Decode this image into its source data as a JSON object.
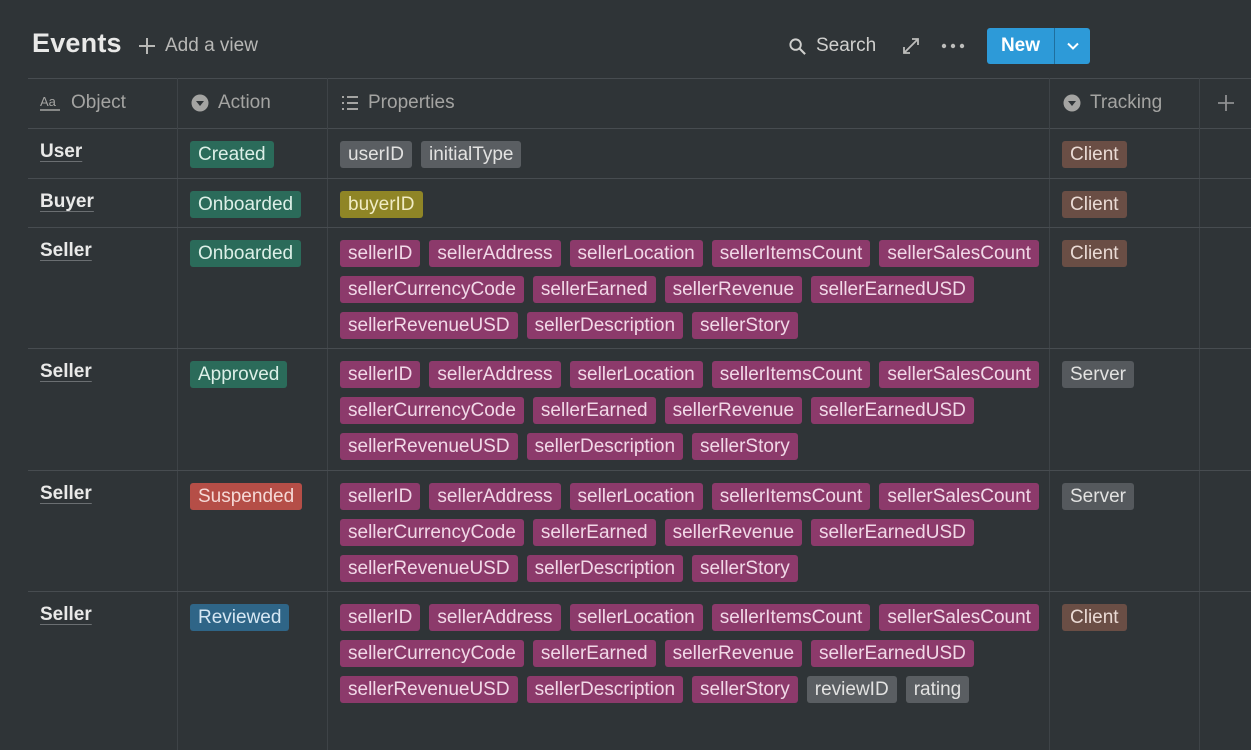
{
  "header": {
    "title": "Events",
    "add_view_label": "Add a view",
    "search_label": "Search",
    "new_label": "New"
  },
  "columns": [
    {
      "label": "Object",
      "icon": "text-aa-icon"
    },
    {
      "label": "Action",
      "icon": "select-icon"
    },
    {
      "label": "Properties",
      "icon": "list-icon"
    },
    {
      "label": "Tracking",
      "icon": "select-icon"
    }
  ],
  "rows": [
    {
      "object": "User",
      "action": "Created",
      "action_color": "green",
      "properties": [
        {
          "label": "userID",
          "color": "gray"
        },
        {
          "label": "initialType",
          "color": "gray"
        }
      ],
      "tracking": "Client",
      "tracking_color": "brown"
    },
    {
      "object": "Buyer",
      "action": "Onboarded",
      "action_color": "green",
      "properties": [
        {
          "label": "buyerID",
          "color": "yellow"
        }
      ],
      "tracking": "Client",
      "tracking_color": "brown"
    },
    {
      "object": "Seller",
      "action": "Onboarded",
      "action_color": "green",
      "properties": [
        {
          "label": "sellerID",
          "color": "pink"
        },
        {
          "label": "sellerAddress",
          "color": "pink"
        },
        {
          "label": "sellerLocation",
          "color": "pink"
        },
        {
          "label": "sellerItemsCount",
          "color": "pink"
        },
        {
          "label": "sellerSalesCount",
          "color": "pink"
        },
        {
          "label": "sellerCurrencyCode",
          "color": "pink"
        },
        {
          "label": "sellerEarned",
          "color": "pink"
        },
        {
          "label": "sellerRevenue",
          "color": "pink"
        },
        {
          "label": "sellerEarnedUSD",
          "color": "pink"
        },
        {
          "label": "sellerRevenueUSD",
          "color": "pink"
        },
        {
          "label": "sellerDescription",
          "color": "pink"
        },
        {
          "label": "sellerStory",
          "color": "pink"
        }
      ],
      "tracking": "Client",
      "tracking_color": "brown"
    },
    {
      "object": "Seller",
      "action": "Approved",
      "action_color": "green",
      "properties": [
        {
          "label": "sellerID",
          "color": "pink"
        },
        {
          "label": "sellerAddress",
          "color": "pink"
        },
        {
          "label": "sellerLocation",
          "color": "pink"
        },
        {
          "label": "sellerItemsCount",
          "color": "pink"
        },
        {
          "label": "sellerSalesCount",
          "color": "pink"
        },
        {
          "label": "sellerCurrencyCode",
          "color": "pink"
        },
        {
          "label": "sellerEarned",
          "color": "pink"
        },
        {
          "label": "sellerRevenue",
          "color": "pink"
        },
        {
          "label": "sellerEarnedUSD",
          "color": "pink"
        },
        {
          "label": "sellerRevenueUSD",
          "color": "pink"
        },
        {
          "label": "sellerDescription",
          "color": "pink"
        },
        {
          "label": "sellerStory",
          "color": "pink"
        }
      ],
      "tracking": "Server",
      "tracking_color": "darkgray"
    },
    {
      "object": "Seller",
      "action": "Suspended",
      "action_color": "red",
      "properties": [
        {
          "label": "sellerID",
          "color": "pink"
        },
        {
          "label": "sellerAddress",
          "color": "pink"
        },
        {
          "label": "sellerLocation",
          "color": "pink"
        },
        {
          "label": "sellerItemsCount",
          "color": "pink"
        },
        {
          "label": "sellerSalesCount",
          "color": "pink"
        },
        {
          "label": "sellerCurrencyCode",
          "color": "pink"
        },
        {
          "label": "sellerEarned",
          "color": "pink"
        },
        {
          "label": "sellerRevenue",
          "color": "pink"
        },
        {
          "label": "sellerEarnedUSD",
          "color": "pink"
        },
        {
          "label": "sellerRevenueUSD",
          "color": "pink"
        },
        {
          "label": "sellerDescription",
          "color": "pink"
        },
        {
          "label": "sellerStory",
          "color": "pink"
        }
      ],
      "tracking": "Server",
      "tracking_color": "darkgray"
    },
    {
      "object": "Seller",
      "action": "Reviewed",
      "action_color": "blue",
      "properties": [
        {
          "label": "sellerID",
          "color": "pink"
        },
        {
          "label": "sellerAddress",
          "color": "pink"
        },
        {
          "label": "sellerLocation",
          "color": "pink"
        },
        {
          "label": "sellerItemsCount",
          "color": "pink"
        },
        {
          "label": "sellerSalesCount",
          "color": "pink"
        },
        {
          "label": "sellerCurrencyCode",
          "color": "pink"
        },
        {
          "label": "sellerEarned",
          "color": "pink"
        },
        {
          "label": "sellerRevenue",
          "color": "pink"
        },
        {
          "label": "sellerEarnedUSD",
          "color": "pink"
        },
        {
          "label": "sellerRevenueUSD",
          "color": "pink"
        },
        {
          "label": "sellerDescription",
          "color": "pink"
        },
        {
          "label": "sellerStory",
          "color": "pink"
        },
        {
          "label": "reviewID",
          "color": "gray"
        },
        {
          "label": "rating",
          "color": "gray"
        }
      ],
      "tracking": "Client",
      "tracking_color": "brown"
    }
  ],
  "colors": {
    "background": "#2f3437",
    "accent": "#2d9ad8",
    "tag_green": "#2b6b5a",
    "tag_red": "#b54e47",
    "tag_blue": "#2f6587",
    "tag_gray": "#5a5e62",
    "tag_yellow": "#8f8526",
    "tag_pink": "#8c3a6b",
    "tag_brown": "#6a4e45"
  }
}
